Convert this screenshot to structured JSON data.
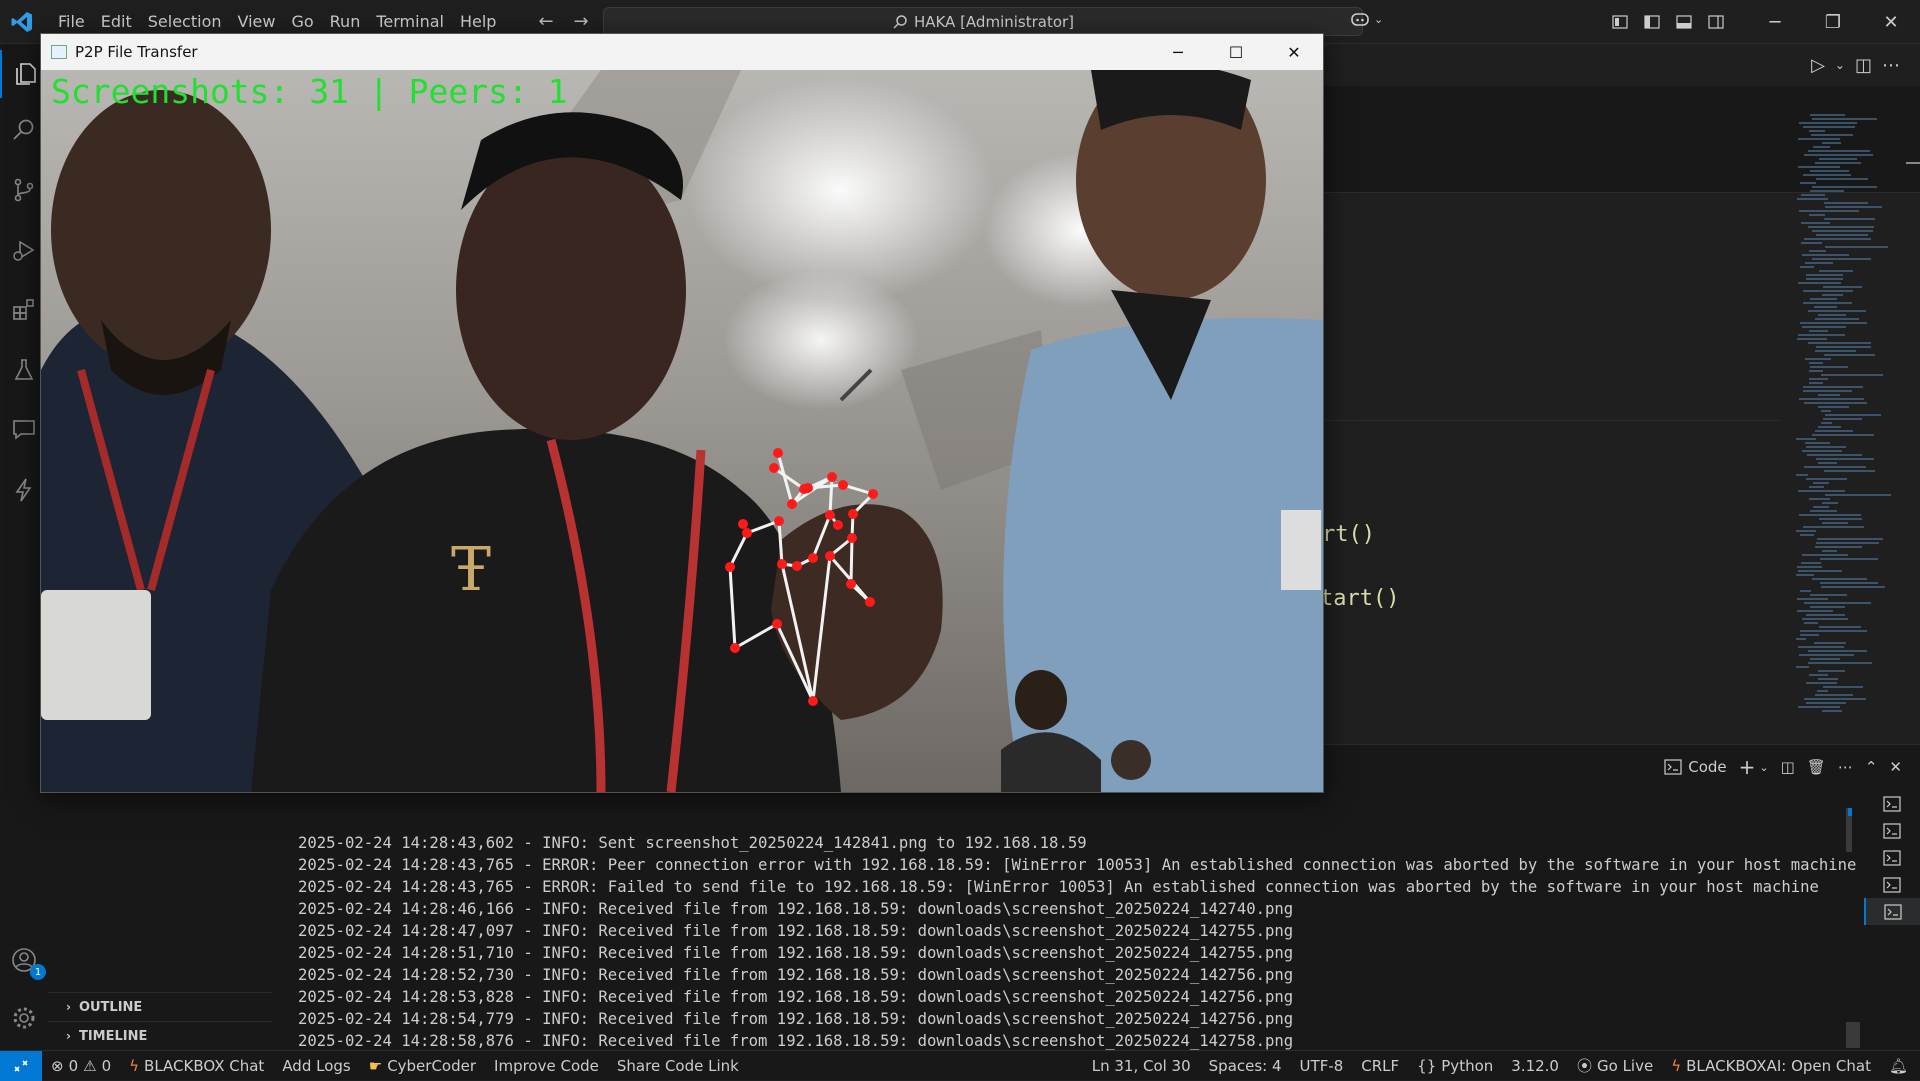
{
  "window_title": "HAKA [Administrator]",
  "menu": [
    "File",
    "Edit",
    "Selection",
    "View",
    "Go",
    "Run",
    "Terminal",
    "Help"
  ],
  "sidebar": {
    "outline": "OUTLINE",
    "timeline": "TIMELINE",
    "accounts_badge": "1"
  },
  "editor": {
    "code_fragment_1": "rt()",
    "code_fragment_2": "tart()"
  },
  "panel": {
    "terminal_tab": "Code",
    "log_lines": [
      "2025-02-24 14:28:43,602 - INFO: Sent screenshot_20250224_142841.png to 192.168.18.59",
      "2025-02-24 14:28:43,765 - ERROR: Peer connection error with 192.168.18.59: [WinError 10053] An established connection was aborted by the software in your host machine",
      "2025-02-24 14:28:43,765 - ERROR: Failed to send file to 192.168.18.59: [WinError 10053] An established connection was aborted by the software in your host machine",
      "2025-02-24 14:28:46,166 - INFO: Received file from 192.168.18.59: downloads\\screenshot_20250224_142740.png",
      "2025-02-24 14:28:47,097 - INFO: Received file from 192.168.18.59: downloads\\screenshot_20250224_142755.png",
      "2025-02-24 14:28:51,710 - INFO: Received file from 192.168.18.59: downloads\\screenshot_20250224_142755.png",
      "2025-02-24 14:28:52,730 - INFO: Received file from 192.168.18.59: downloads\\screenshot_20250224_142756.png",
      "2025-02-24 14:28:53,828 - INFO: Received file from 192.168.18.59: downloads\\screenshot_20250224_142756.png",
      "2025-02-24 14:28:54,779 - INFO: Received file from 192.168.18.59: downloads\\screenshot_20250224_142756.png",
      "2025-02-24 14:28:58,876 - INFO: Received file from 192.168.18.59: downloads\\screenshot_20250224_142758.png"
    ]
  },
  "p2p_window": {
    "title": "P2P File Transfer",
    "overlay": "Screenshots: 31 | Peers: 1"
  },
  "statusbar": {
    "errors": "0",
    "warnings": "0",
    "left_items": [
      "BLACKBOX Chat",
      "Add Logs",
      "CyberCoder",
      "Improve Code",
      "Share Code Link"
    ],
    "position": "Ln 31, Col 30",
    "spaces": "Spaces: 4",
    "encoding": "UTF-8",
    "eol": "CRLF",
    "language": "Python",
    "version": "3.12.0",
    "go_live": "Go Live",
    "blackbox_open": "BLACKBOXAI: Open Chat"
  },
  "colors": {
    "accent": "#0078d4",
    "overlay_text": "#22e030",
    "landmark": "#ff1a1a"
  }
}
